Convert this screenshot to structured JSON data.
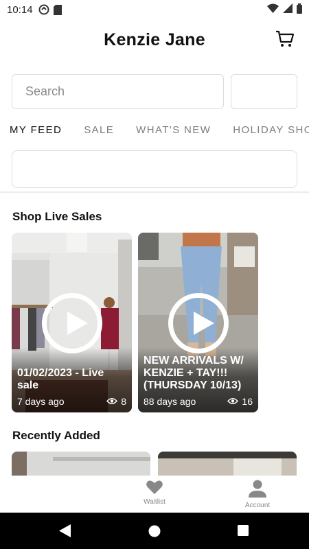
{
  "status_bar": {
    "time": "10:14"
  },
  "header": {
    "title": "Kenzie Jane"
  },
  "search": {
    "placeholder": "Search"
  },
  "tabs": [
    {
      "label": "MY FEED",
      "active": true
    },
    {
      "label": "SALE",
      "active": false
    },
    {
      "label": "WHAT'S NEW",
      "active": false
    },
    {
      "label": "HOLIDAY SHO",
      "active": false
    }
  ],
  "live_sales": {
    "title": "Shop Live Sales",
    "items": [
      {
        "title": "01/02/2023 - Live sale",
        "age": "7 days ago",
        "views": "8"
      },
      {
        "title": "NEW ARRIVALS W/ KENZIE + TAY!!! (THURSDAY 10/13)",
        "age": "88 days ago",
        "views": "16"
      }
    ]
  },
  "recently_added": {
    "title": "Recently Added"
  },
  "bottom_nav": {
    "items": [
      {
        "label": "Waitlist",
        "icon": "heart-icon"
      },
      {
        "label": "Account",
        "icon": "person-icon"
      }
    ]
  },
  "colors": {
    "tab_inactive": "#7d7d7d",
    "nav_label": "#888888"
  }
}
